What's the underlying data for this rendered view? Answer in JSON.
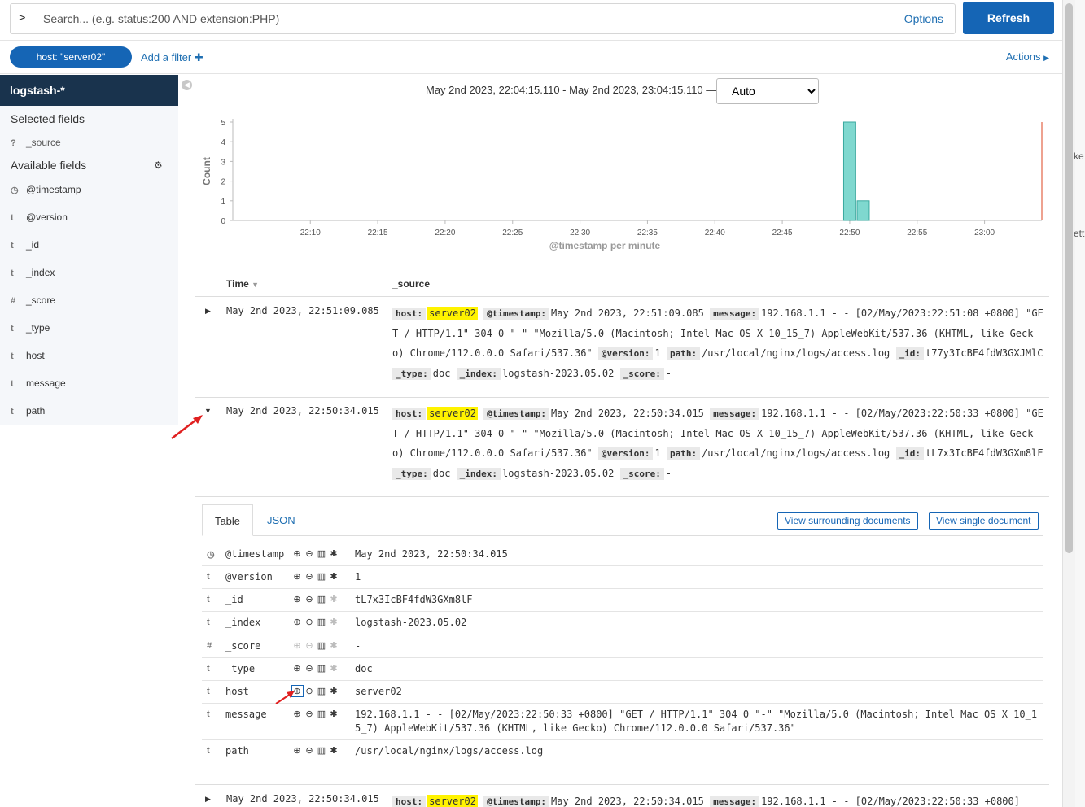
{
  "querybar": {
    "prompt": ">_",
    "placeholder": "Search... (e.g. status:200 AND extension:PHP)",
    "options_label": "Options",
    "refresh_label": "Refresh"
  },
  "filterbar": {
    "filter_pill": "host: \"server02\"",
    "add_filter_label": "Add a filter",
    "actions_label": "Actions"
  },
  "sidebar": {
    "index_pattern": "logstash-*",
    "selected_heading": "Selected fields",
    "selected_fields": [
      {
        "type": "?",
        "name": "_source"
      }
    ],
    "available_heading": "Available fields",
    "available_fields": [
      {
        "type": "◷",
        "name": "@timestamp"
      },
      {
        "type": "t",
        "name": "@version"
      },
      {
        "type": "t",
        "name": "_id"
      },
      {
        "type": "t",
        "name": "_index"
      },
      {
        "type": "#",
        "name": "_score"
      },
      {
        "type": "t",
        "name": "_type"
      },
      {
        "type": "t",
        "name": "host"
      },
      {
        "type": "t",
        "name": "message"
      },
      {
        "type": "t",
        "name": "path"
      }
    ]
  },
  "timerange": {
    "text": "May 2nd 2023, 22:04:15.110 - May 2nd 2023, 23:04:15.110 —",
    "interval": "Auto"
  },
  "chart_data": {
    "type": "bar",
    "title": "",
    "xlabel": "@timestamp per minute",
    "ylabel": "Count",
    "ylim": [
      0,
      5
    ],
    "yticks": [
      0,
      1,
      2,
      3,
      4,
      5
    ],
    "xticks": [
      "22:10",
      "22:15",
      "22:20",
      "22:25",
      "22:30",
      "22:35",
      "22:40",
      "22:45",
      "22:50",
      "22:55",
      "23:00"
    ],
    "x_range_minutes": [
      4.25,
      64.25
    ],
    "x_tick_start_minute": 10,
    "bars": [
      {
        "minute": 50,
        "value": 5
      },
      {
        "minute": 51,
        "value": 1
      }
    ],
    "now_marker_minute": 64.25,
    "bar_color": "#7fd8cf",
    "bar_stroke": "#3aa99f"
  },
  "table": {
    "col_time": "Time",
    "col_source": "_source",
    "rows": [
      {
        "time": "May 2nd 2023, 22:51:09.085",
        "host": "server02",
        "timestamp": "May 2nd 2023, 22:51:09.085",
        "message": "192.168.1.1 - - [02/May/2023:22:51:08 +0800] \"GET / HTTP/1.1\" 304 0 \"-\" \"Mozilla/5.0 (Macintosh; Intel Mac OS X 10_15_7) AppleWebKit/537.36 (KHTML, like Gecko) Chrome/112.0.0.0 Safari/537.36\"",
        "version": "1",
        "path": "/usr/local/nginx/logs/access.log",
        "id": "t77y3IcBF4fdW3GXJMlC",
        "type": "doc",
        "index": "logstash-2023.05.02",
        "score": "-"
      },
      {
        "time": "May 2nd 2023, 22:50:34.015",
        "host": "server02",
        "timestamp": "May 2nd 2023, 22:50:34.015",
        "message": "192.168.1.1 - - [02/May/2023:22:50:33 +0800] \"GET / HTTP/1.1\" 304 0 \"-\" \"Mozilla/5.0 (Macintosh; Intel Mac OS X 10_15_7) AppleWebKit/537.36 (KHTML, like Gecko) Chrome/112.0.0.0 Safari/537.36\"",
        "version": "1",
        "path": "/usr/local/nginx/logs/access.log",
        "id": "tL7x3IcBF4fdW3GXm8lF",
        "type": "doc",
        "index": "logstash-2023.05.02",
        "score": "-"
      },
      {
        "time": "May 2nd 2023, 22:50:34.015",
        "host": "server02",
        "timestamp": "May 2nd 2023, 22:50:34.015",
        "message": "192.168.1.1 - - [02/May/2023:22:50:33 +0800]"
      }
    ]
  },
  "source_keys": {
    "host": "host:",
    "timestamp": "@timestamp:",
    "message": "message:",
    "version": "@version:",
    "path": "path:",
    "id": "_id:",
    "type": "_type:",
    "index": "_index:",
    "score": "_score:"
  },
  "detail": {
    "tab_table": "Table",
    "tab_json": "JSON",
    "surrounding_label": "View surrounding documents",
    "single_label": "View single document",
    "fields": [
      {
        "type": "◷",
        "name": "@timestamp",
        "value": "May 2nd 2023, 22:50:34.015"
      },
      {
        "type": "t",
        "name": "@version",
        "value": "1"
      },
      {
        "type": "t",
        "name": "_id",
        "value": "tL7x3IcBF4fdW3GXm8lF"
      },
      {
        "type": "t",
        "name": "_index",
        "value": "logstash-2023.05.02"
      },
      {
        "type": "#",
        "name": "_score",
        "value": "-"
      },
      {
        "type": "t",
        "name": "_type",
        "value": "doc"
      },
      {
        "type": "t",
        "name": "host",
        "value": "server02"
      },
      {
        "type": "t",
        "name": "message",
        "value": "192.168.1.1 - - [02/May/2023:22:50:33 +0800] \"GET / HTTP/1.1\" 304 0 \"-\" \"Mozilla/5.0 (Macintosh; Intel Mac OS X 10_15_7) AppleWebKit/537.36 (KHTML, like Gecko) Chrome/112.0.0.0 Safari/537.36\""
      },
      {
        "type": "t",
        "name": "path",
        "value": "/usr/local/nginx/logs/access.log"
      }
    ]
  },
  "edge": {
    "text1": "ke",
    "text2": "ett"
  },
  "colors": {
    "accent": "#1565b5",
    "highlight": "#fff300",
    "sidebar_header": "#19334d",
    "annotation_arrow": "#e02020"
  }
}
